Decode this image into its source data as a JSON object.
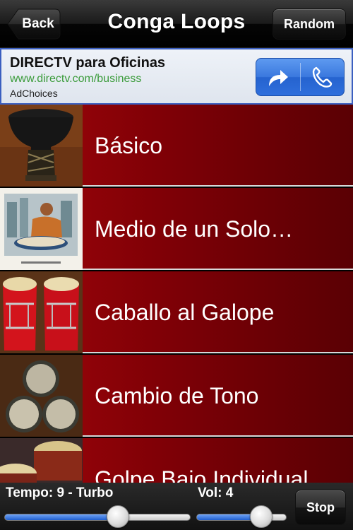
{
  "navbar": {
    "title": "Conga Loops",
    "back_label": "Back",
    "random_label": "Random"
  },
  "ad": {
    "title": "DIRECTV para Oficinas",
    "url": "www.directv.com/business",
    "choices": "AdChoices",
    "actions": [
      "share-arrow-icon",
      "phone-icon"
    ],
    "border_color": "#3b5fc0",
    "url_color": "#3a9b3a"
  },
  "loops": [
    {
      "label": "Básico",
      "thumbnail": "djembe-drum"
    },
    {
      "label": "Medio de un Solo…",
      "thumbnail": "conga-player-illustration"
    },
    {
      "label": "Caballo al Galope",
      "thumbnail": "red-conga-drums"
    },
    {
      "label": "Cambio de Tono",
      "thumbnail": "conga-drum-tops"
    },
    {
      "label": "Golpe Bajo Individual",
      "thumbnail": "conga-drums-closeup"
    }
  ],
  "controls": {
    "tempo_label": "Tempo: 9 - Turbo",
    "tempo_fraction": 0.61,
    "volume_label": "Vol: 4",
    "volume_fraction": 0.72,
    "stop_label": "Stop"
  },
  "colors": {
    "row_red": "#8a0006",
    "slider_blue": "#2f6fdc"
  }
}
